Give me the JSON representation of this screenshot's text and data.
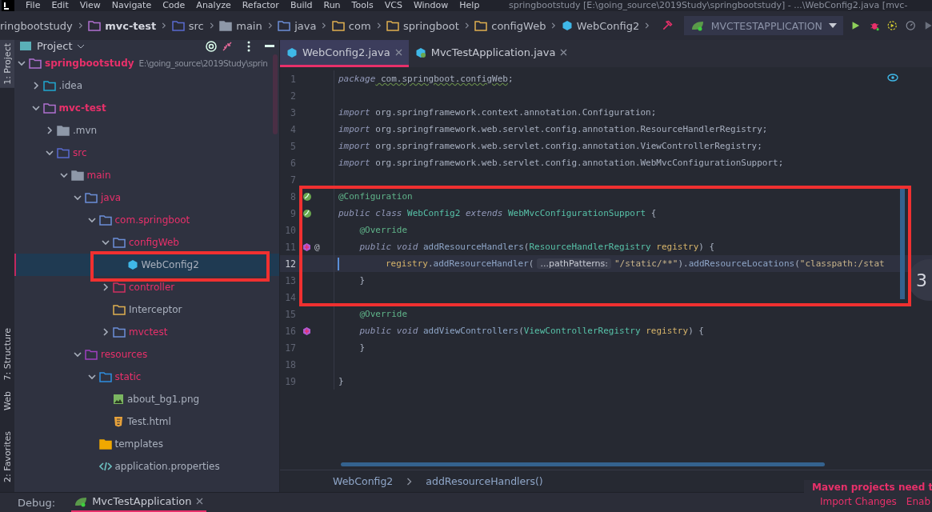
{
  "menu_bar": {
    "items": [
      "File",
      "Edit",
      "View",
      "Navigate",
      "Code",
      "Analyze",
      "Refactor",
      "Build",
      "Run",
      "Tools",
      "VCS",
      "Window",
      "Help"
    ],
    "title": "springbootstudy [E:\\going_source\\2019Study\\springbootstudy] - ...\\WebConfig2.java [mvc-"
  },
  "navigation_bar": {
    "crumbs": [
      {
        "label": "ringbootstudy",
        "kind": "project"
      },
      {
        "label": "mvc-test",
        "kind": "module"
      },
      {
        "label": "src",
        "kind": "source"
      },
      {
        "label": "main",
        "kind": "folder"
      },
      {
        "label": "java",
        "kind": "java"
      },
      {
        "label": "com",
        "kind": "package"
      },
      {
        "label": "springboot",
        "kind": "package"
      },
      {
        "label": "configWeb",
        "kind": "package"
      },
      {
        "label": "WebConfig2",
        "kind": "class"
      }
    ],
    "run_configuration": "MVCTESTAPPLICATION"
  },
  "tool_strip": [
    {
      "label": "1: Project",
      "selected": true
    },
    {
      "label": "7: Structure",
      "selected": false
    },
    {
      "label": "Web",
      "selected": false
    },
    {
      "label": "2: Favorites",
      "selected": false
    }
  ],
  "project_panel": {
    "title": "Project",
    "tree": [
      {
        "name": "springbootstudy",
        "path": "E:\\going_source\\2019Study\\sprin",
        "kind": "module",
        "modified": true,
        "expanded": true,
        "selected": false,
        "children": [
          {
            "name": ".idea",
            "kind": "idea",
            "modified": false,
            "expanded": false,
            "selected": false
          },
          {
            "name": "mvc-test",
            "kind": "module",
            "modified": true,
            "expanded": true,
            "selected": false,
            "children": [
              {
                "name": ".mvn",
                "kind": "folder",
                "modified": false,
                "expanded": false,
                "selected": false
              },
              {
                "name": "src",
                "kind": "source",
                "modified": true,
                "expanded": true,
                "selected": false,
                "children": [
                  {
                    "name": "main",
                    "kind": "folder",
                    "modified": true,
                    "expanded": true,
                    "selected": false,
                    "children": [
                      {
                        "name": "java",
                        "kind": "java",
                        "modified": true,
                        "expanded": true,
                        "selected": false,
                        "children": [
                          {
                            "name": "com.springboot",
                            "kind": "java",
                            "modified": true,
                            "expanded": true,
                            "selected": false,
                            "children": [
                              {
                                "name": "configWeb",
                                "kind": "java",
                                "modified": true,
                                "expanded": true,
                                "selected": false,
                                "children": [
                                  {
                                    "name": "WebConfig2",
                                    "kind": "class",
                                    "modified": false,
                                    "selected": true
                                  }
                                ]
                              },
                              {
                                "name": "controller",
                                "kind": "controller",
                                "modified": true,
                                "expanded": false,
                                "selected": false
                              },
                              {
                                "name": "Interceptor",
                                "kind": "package",
                                "modified": false,
                                "selected": false
                              },
                              {
                                "name": "mvctest",
                                "kind": "java",
                                "modified": true,
                                "expanded": false,
                                "selected": false
                              }
                            ]
                          }
                        ]
                      },
                      {
                        "name": "resources",
                        "kind": "resources",
                        "modified": true,
                        "expanded": true,
                        "selected": false,
                        "children": [
                          {
                            "name": "static",
                            "kind": "web",
                            "modified": true,
                            "expanded": true,
                            "selected": false,
                            "children": [
                              {
                                "name": "about_bg1.png",
                                "kind": "image",
                                "modified": false,
                                "selected": false
                              },
                              {
                                "name": "Test.html",
                                "kind": "html",
                                "modified": false,
                                "selected": false
                              }
                            ]
                          },
                          {
                            "name": "templates",
                            "kind": "templates",
                            "modified": false,
                            "selected": false
                          },
                          {
                            "name": "application.properties",
                            "kind": "properties",
                            "modified": false,
                            "selected": false
                          }
                        ]
                      }
                    ]
                  }
                ]
              }
            ]
          }
        ]
      }
    ]
  },
  "editor": {
    "tabs": [
      {
        "label": "WebConfig2.java",
        "kind": "class",
        "selected": true
      },
      {
        "label": "MvcTestApplication.java",
        "kind": "app",
        "selected": false
      }
    ],
    "lines": [
      {
        "number": "1",
        "kind": "plain",
        "current": false,
        "tokens": [
          {
            "text": "package",
            "kind": "keyword"
          },
          {
            "text": " com.springboot.configWeb",
            "kind": "warn"
          },
          {
            "text": ";",
            "kind": "plain"
          }
        ]
      },
      {
        "number": "2",
        "kind": "plain",
        "current": false
      },
      {
        "number": "3",
        "kind": "plain",
        "current": false,
        "tokens": [
          {
            "text": "import",
            "kind": "keyword"
          },
          {
            "text": " org.springframework.context.annotation.Configuration;",
            "kind": "plain"
          }
        ]
      },
      {
        "number": "4",
        "kind": "plain",
        "current": false,
        "tokens": [
          {
            "text": "import",
            "kind": "keyword"
          },
          {
            "text": " org.springframework.web.servlet.config.annotation.ResourceHandlerRegistry;",
            "kind": "plain"
          }
        ]
      },
      {
        "number": "5",
        "kind": "plain",
        "current": false,
        "tokens": [
          {
            "text": "import",
            "kind": "keyword"
          },
          {
            "text": " org.springframework.web.servlet.config.annotation.ViewControllerRegistry;",
            "kind": "plain"
          }
        ]
      },
      {
        "number": "6",
        "kind": "plain",
        "current": false,
        "tokens": [
          {
            "text": "import",
            "kind": "keyword"
          },
          {
            "text": " org.springframework.web.servlet.config.annotation.WebMvcConfigurationSupport;",
            "kind": "plain"
          }
        ]
      },
      {
        "number": "7",
        "kind": "plain",
        "current": false
      },
      {
        "number": "8",
        "kind": "bean",
        "current": false,
        "tokens": [
          {
            "text": "@Configuration",
            "kind": "annotation"
          }
        ]
      },
      {
        "number": "9",
        "kind": "bean",
        "current": false,
        "tokens": [
          {
            "text": "public class",
            "kind": "keyword"
          },
          {
            "text": " WebConfig2 ",
            "kind": "class"
          },
          {
            "text": "extends",
            "kind": "keyword"
          },
          {
            "text": " WebMvcConfigurationSupport",
            "kind": "class"
          },
          {
            "text": " {",
            "kind": "plain"
          }
        ]
      },
      {
        "number": "10",
        "kind": "plain",
        "current": false,
        "tokens": [
          {
            "text": "    @Override",
            "kind": "annotation"
          }
        ]
      },
      {
        "number": "11",
        "kind": "override",
        "current": false,
        "gutter_text": "@",
        "tokens": [
          {
            "text": "    public void",
            "kind": "keyword"
          },
          {
            "text": " addResourceHandlers",
            "kind": "method"
          },
          {
            "text": "(",
            "kind": "plain"
          },
          {
            "text": "ResourceHandlerRegistry",
            "kind": "class"
          },
          {
            "text": " registry",
            "kind": "param"
          },
          {
            "text": ") {",
            "kind": "plain"
          }
        ]
      },
      {
        "number": "12",
        "kind": "plain",
        "current": true,
        "tokens": [
          {
            "text": "        registry",
            "kind": "param"
          },
          {
            "text": ".",
            "kind": "plain"
          },
          {
            "text": "addResourceHandler",
            "kind": "method"
          },
          {
            "text": "(",
            "kind": "plain"
          },
          {
            "text": "...pathPatterns:",
            "kind": "hint"
          },
          {
            "text": "\"/static/**\"",
            "kind": "string"
          },
          {
            "text": ").",
            "kind": "plain"
          },
          {
            "text": "addResourceLocations",
            "kind": "method"
          },
          {
            "text": "(",
            "kind": "plain"
          },
          {
            "text": "\"classpath:/stat",
            "kind": "string"
          }
        ]
      },
      {
        "number": "13",
        "kind": "plain",
        "current": false,
        "tokens": [
          {
            "text": "    }",
            "kind": "plain"
          }
        ]
      },
      {
        "number": "14",
        "kind": "plain",
        "current": false
      },
      {
        "number": "15",
        "kind": "plain",
        "current": false,
        "tokens": [
          {
            "text": "    @Override",
            "kind": "annotation"
          }
        ]
      },
      {
        "number": "16",
        "kind": "override",
        "current": false,
        "tokens": [
          {
            "text": "    public void",
            "kind": "keyword"
          },
          {
            "text": " addViewControllers",
            "kind": "method"
          },
          {
            "text": "(",
            "kind": "plain"
          },
          {
            "text": "ViewControllerRegistry",
            "kind": "class"
          },
          {
            "text": " registry",
            "kind": "param"
          },
          {
            "text": ") {",
            "kind": "plain"
          }
        ]
      },
      {
        "number": "17",
        "kind": "plain",
        "current": false,
        "tokens": [
          {
            "text": "    }",
            "kind": "plain"
          }
        ]
      },
      {
        "number": "18",
        "kind": "plain",
        "current": false
      },
      {
        "number": "19",
        "kind": "plain",
        "current": false,
        "tokens": [
          {
            "text": "}",
            "kind": "plain"
          }
        ]
      }
    ],
    "floating_badge": "3",
    "breadcrumbs": [
      "WebConfig2",
      "addResourceHandlers()"
    ]
  },
  "debug_bar": {
    "label": "Debug:",
    "tabs": [
      {
        "label": "MvcTestApplication",
        "selected": true
      }
    ]
  },
  "notification": {
    "title": "Maven projects need t",
    "actions": [
      "Import Changes",
      "Enab"
    ]
  }
}
